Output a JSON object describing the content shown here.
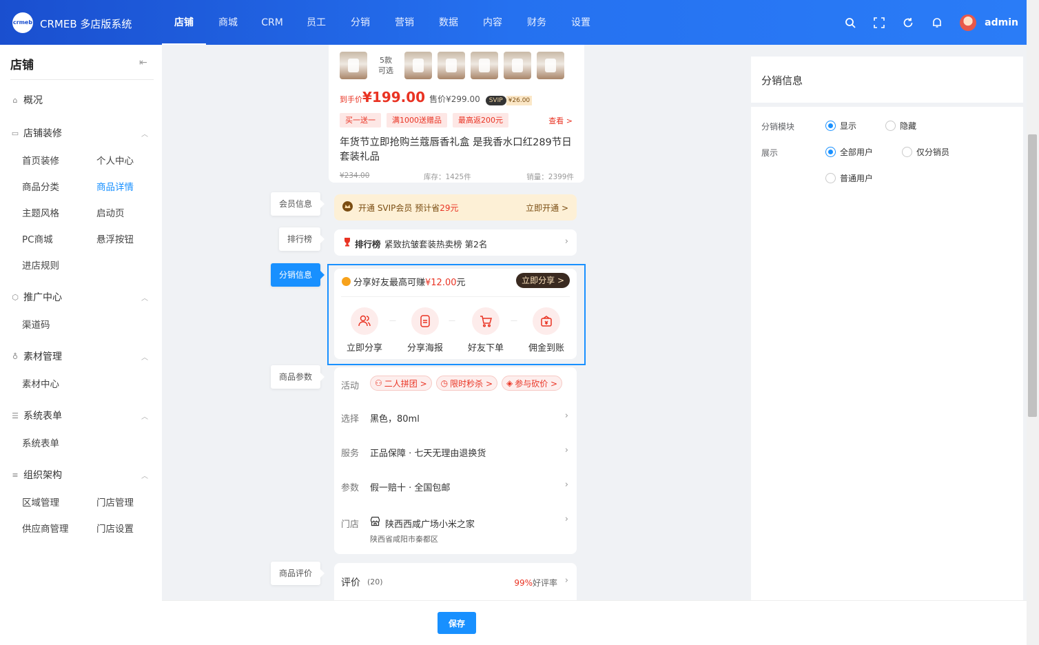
{
  "header": {
    "logo_text": "crmeb",
    "brand": "CRMEB 多店版系统",
    "nav": [
      "店铺",
      "商城",
      "CRM",
      "员工",
      "分销",
      "营销",
      "数据",
      "内容",
      "财务",
      "设置"
    ],
    "user": "admin",
    "icons": [
      "search-icon",
      "fullscreen-icon",
      "refresh-icon",
      "bell-icon"
    ]
  },
  "sidebar": {
    "title": "店铺",
    "collapse_icon": "collapse-icon",
    "overview": "概况",
    "groups": [
      {
        "label": "店铺装修",
        "icon": "monitor-icon",
        "items": [
          "首页装修",
          "个人中心",
          "商品分类",
          "商品详情",
          "主题风格",
          "启动页",
          "PC商城",
          "悬浮按钮",
          "进店规则"
        ]
      },
      {
        "label": "推广中心",
        "icon": "cube-icon",
        "items": [
          "渠道码"
        ]
      },
      {
        "label": "素材管理",
        "icon": "bulb-icon",
        "items": [
          "素材中心"
        ]
      },
      {
        "label": "系统表单",
        "icon": "sliders-icon",
        "items": [
          "系统表单"
        ]
      },
      {
        "label": "组织架构",
        "icon": "filter-icon",
        "items": [
          "区域管理",
          "门店管理",
          "供应商管理",
          "门店设置"
        ]
      }
    ],
    "active_item": "商品详情"
  },
  "preview": {
    "thumb_count_text": "5款",
    "thumb_count_sub": "可选",
    "price_prefix": "到手价",
    "price": "¥199.00",
    "sale_price": "售价¥299.00",
    "svip_badge": "SVIP",
    "svip_price": "¥26.00",
    "coupons": [
      "买一送一",
      "满1000送赠品",
      "最高返200元"
    ],
    "coupon_more": "查看 >",
    "product_title": "年货节立即抢购兰蔻唇香礼盒 是我香水口红289节日套装礼品",
    "original_price": "¥234.00",
    "stock": "库存：1425件",
    "sales": "销量：2399件",
    "labels": {
      "member": "会员信息",
      "rank": "排行榜",
      "distribution": "分销信息",
      "params": "商品参数",
      "review": "商品评价"
    },
    "member_bar": {
      "text_prefix": "开通 SVIP会员 预计省",
      "amount": "29元",
      "action": "立即开通 >"
    },
    "rank_bar": {
      "badge": "排行榜",
      "text": "紧致抗皱套装热卖榜 第2名"
    },
    "share": {
      "text_prefix": "分享好友最高可赚",
      "amount": "¥12.00",
      "text_suffix": "元",
      "button": "立即分享 >",
      "steps": [
        "立即分享",
        "分享海报",
        "好友下单",
        "佣金到账"
      ]
    },
    "params": {
      "activity_label": "活动",
      "activities": [
        "二人拼团 >",
        "限时秒杀 >",
        "参与砍价 >"
      ],
      "select_label": "选择",
      "select_value": "黑色，80ml",
      "service_label": "服务",
      "service_value": "正品保障 · 七天无理由退换货",
      "param_label": "参数",
      "param_value": "假一赔十 · 全国包邮",
      "store_label": "门店",
      "store_name": "陕西西咸广场小米之家",
      "store_address": "陕西省咸阳市秦都区"
    },
    "review": {
      "title": "评价",
      "count": "(20)",
      "rate": "99%",
      "rate_suffix": "好评率"
    }
  },
  "settings": {
    "title": "分销信息",
    "module_label": "分销模块",
    "module_options": [
      "显示",
      "隐藏"
    ],
    "module_selected": "显示",
    "display_label": "展示",
    "display_options": [
      "全部用户",
      "仅分销员",
      "普通用户"
    ],
    "display_selected": "全部用户"
  },
  "footer": {
    "save": "保存"
  },
  "colors": {
    "primary": "#1890ff",
    "header_start": "#1a4fcf",
    "price_red": "#e93323"
  }
}
